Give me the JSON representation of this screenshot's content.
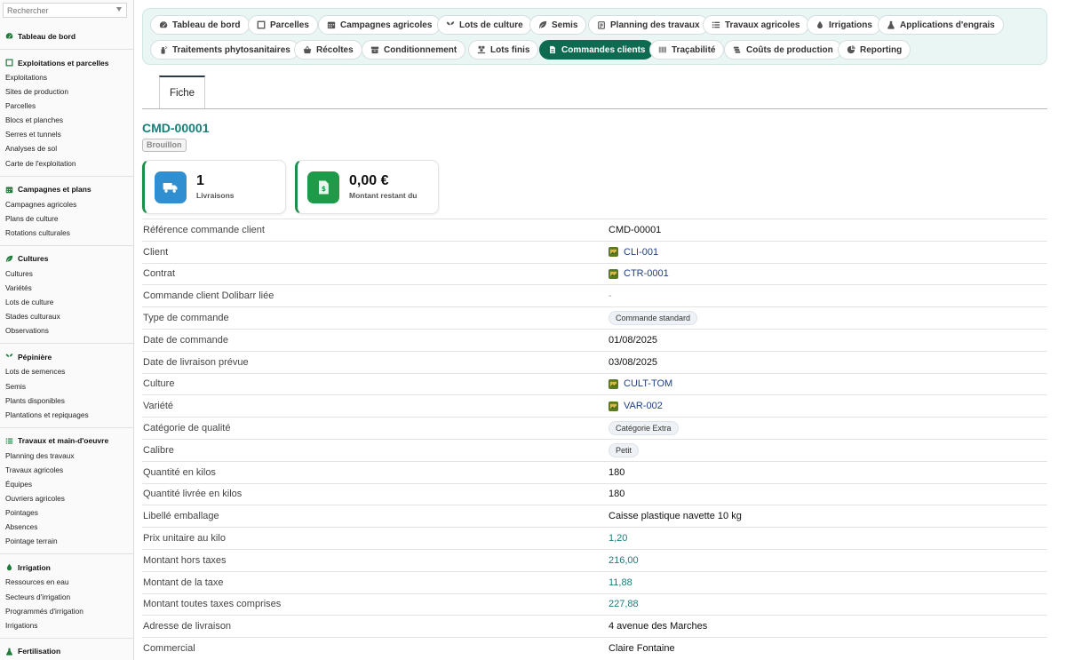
{
  "search": {
    "placeholder": "Rechercher"
  },
  "sidebar": {
    "sections": [
      {
        "title": "Tableau de bord",
        "icon": "dashboard-icon",
        "items": []
      },
      {
        "title": "Exploitations et parcelles",
        "icon": "map-icon",
        "items": [
          "Exploitations",
          "Sites de production",
          "Parcelles",
          "Blocs et planches",
          "Serres et tunnels",
          "Analyses de sol",
          "Carte de l'exploitation"
        ]
      },
      {
        "title": "Campagnes et plans",
        "icon": "calendar-icon",
        "items": [
          "Campagnes agricoles",
          "Plans de culture",
          "Rotations culturales"
        ]
      },
      {
        "title": "Cultures",
        "icon": "leaf-icon",
        "items": [
          "Cultures",
          "Variétés",
          "Lots de culture",
          "Stades culturaux",
          "Observations"
        ]
      },
      {
        "title": "Pépinière",
        "icon": "sprout-icon",
        "items": [
          "Lots de semences",
          "Semis",
          "Plants disponibles",
          "Plantations et repiquages"
        ]
      },
      {
        "title": "Travaux et main-d'oeuvre",
        "icon": "list-icon",
        "items": [
          "Planning des travaux",
          "Travaux agricoles",
          "Équipes",
          "Ouvriers agricoles",
          "Pointages",
          "Absences",
          "Pointage terrain"
        ]
      },
      {
        "title": "Irrigation",
        "icon": "drop-icon",
        "items": [
          "Ressources en eau",
          "Secteurs d'irrigation",
          "Programmés d'irrigation",
          "Irrigations"
        ]
      },
      {
        "title": "Fertilisation",
        "icon": "flask-icon",
        "items": []
      }
    ]
  },
  "tabs": [
    {
      "label": "Tableau de bord",
      "icon": "dashboard-icon"
    },
    {
      "label": "Parcelles",
      "icon": "map-icon"
    },
    {
      "label": "Campagnes agricoles",
      "icon": "calendar-icon"
    },
    {
      "label": "Lots de culture",
      "icon": "sprout-icon"
    },
    {
      "label": "Semis",
      "icon": "leaf-icon"
    },
    {
      "label": "Planning des travaux",
      "icon": "clipboard-icon"
    },
    {
      "label": "Travaux agricoles",
      "icon": "list-icon"
    },
    {
      "label": "Irrigations",
      "icon": "drop-icon"
    },
    {
      "label": "Applications d'engrais",
      "icon": "flask-icon"
    },
    {
      "label": "Traitements phytosanitaires",
      "icon": "spray-icon"
    },
    {
      "label": "Récoltes",
      "icon": "basket-icon"
    },
    {
      "label": "Conditionnement",
      "icon": "box-icon"
    },
    {
      "label": "Lots finis",
      "icon": "pallet-icon"
    },
    {
      "label": "Commandes clients",
      "icon": "document-icon",
      "active": true
    },
    {
      "label": "Traçabilité",
      "icon": "barcode-icon"
    },
    {
      "label": "Coûts de production",
      "icon": "coins-icon"
    },
    {
      "label": "Reporting",
      "icon": "chart-icon"
    }
  ],
  "subtab": {
    "label": "Fiche"
  },
  "record": {
    "ref": "CMD-00001",
    "status": "Brouillon"
  },
  "cards": [
    {
      "value": "1",
      "label": "Livraisons",
      "icon": "truck-icon",
      "color": "#2f8fd0"
    },
    {
      "value": "0,00 €",
      "label": "Montant restant du",
      "icon": "money-icon",
      "color": "#1f9a48"
    }
  ],
  "fields": [
    {
      "label": "Référence commande client",
      "value": "CMD-00001",
      "type": "text"
    },
    {
      "label": "Client",
      "value": "CLI-001",
      "type": "link"
    },
    {
      "label": "Contrat",
      "value": "CTR-0001",
      "type": "link"
    },
    {
      "label": "Commande client Dolibarr liée",
      "value": "-",
      "type": "muted"
    },
    {
      "label": "Type de commande",
      "value": "Commande standard",
      "type": "pill"
    },
    {
      "label": "Date de commande",
      "value": "01/08/2025",
      "type": "text"
    },
    {
      "label": "Date de livraison prévue",
      "value": "03/08/2025",
      "type": "text"
    },
    {
      "label": "Culture",
      "value": "CULT-TOM",
      "type": "link"
    },
    {
      "label": "Variété",
      "value": "VAR-002",
      "type": "link"
    },
    {
      "label": "Catégorie de qualité",
      "value": "Catégorie Extra",
      "type": "pill"
    },
    {
      "label": "Calibre",
      "value": "Petit",
      "type": "pill"
    },
    {
      "label": "Quantité en kilos",
      "value": "180",
      "type": "text"
    },
    {
      "label": "Quantité livrée en kilos",
      "value": "180",
      "type": "text"
    },
    {
      "label": "Libellé emballage",
      "value": "Caisse plastique navette 10 kg",
      "type": "text"
    },
    {
      "label": "Prix unitaire au kilo",
      "value": "1,20",
      "type": "num"
    },
    {
      "label": "Montant hors taxes",
      "value": "216,00",
      "type": "num"
    },
    {
      "label": "Montant de la taxe",
      "value": "11,88",
      "type": "num"
    },
    {
      "label": "Montant toutes taxes comprises",
      "value": "227,88",
      "type": "num"
    },
    {
      "label": "Adresse de livraison",
      "value": "4 avenue des Marches",
      "type": "text"
    },
    {
      "label": "Commercial",
      "value": "Claire Fontaine",
      "type": "text"
    }
  ]
}
